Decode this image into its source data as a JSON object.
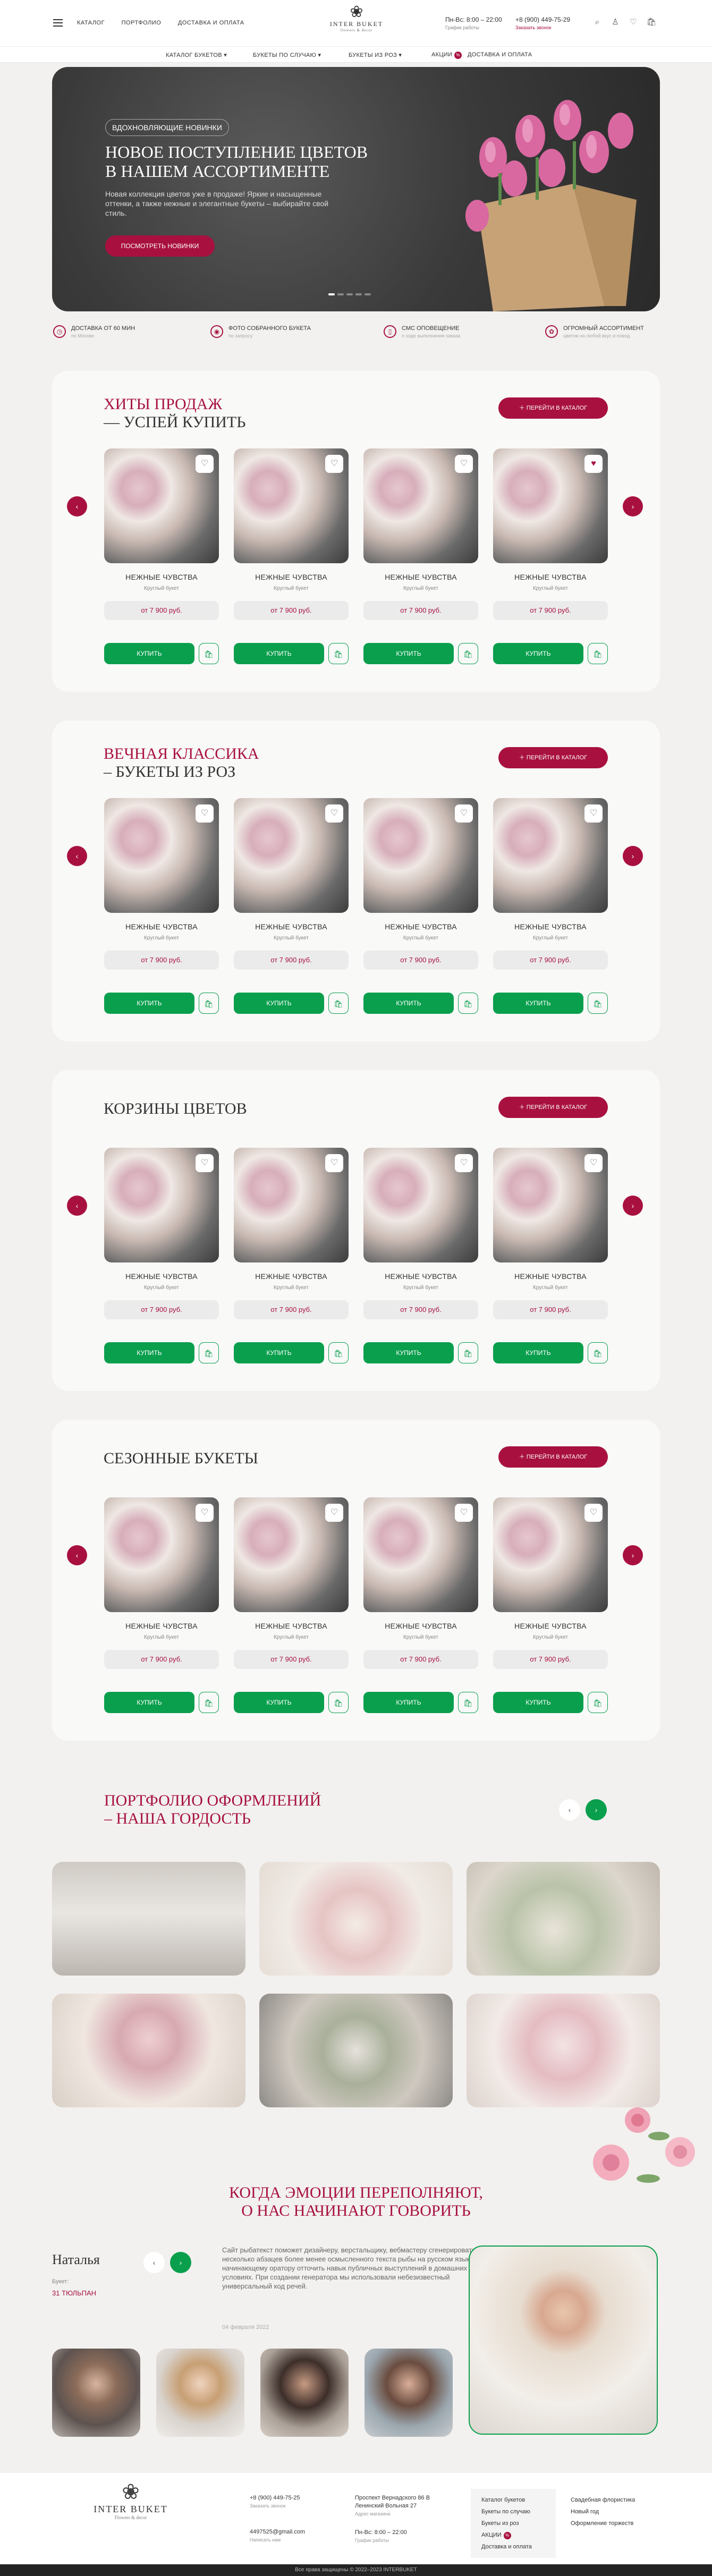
{
  "header": {
    "nav": [
      "КАТАЛОГ",
      "ПОРТФОЛИО",
      "ДОСТАВКА И ОПЛАТА"
    ],
    "logo_name": "INTER BUKET",
    "logo_sub": "flowers & decor",
    "hours": "Пн-Вс: 8:00 – 22:00",
    "hours_sub": "График работы",
    "phone": "+8 (900) 449-75-29",
    "phone_sub": "Заказать звонок",
    "cart_count": "0"
  },
  "catnav": {
    "items": [
      "КАТАЛОГ БУКЕТОВ",
      "БУКЕТЫ ПО СЛУЧАЮ",
      "БУКЕТЫ ИЗ РОЗ",
      "АКЦИИ",
      "ДОСТАВКА И ОПЛАТА"
    ],
    "sale_badge": "%"
  },
  "hero": {
    "tag": "ВДОХНОВЛЯЮЩИЕ НОВИНКИ",
    "title": "НОВОЕ ПОСТУПЛЕНИЕ ЦВЕТОВ В НАШЕМ АССОРТИМЕНТЕ",
    "text": "Новая коллекция цветов уже в продаже! Яркие и насыщенные оттенки, а также нежные и элегантные букеты – выбирайте свой стиль.",
    "button": "ПОСМОТРЕТЬ НОВИНКИ"
  },
  "features": [
    {
      "title": "ДОСТАВКА ОТ 60 МИН",
      "sub": "по Москве"
    },
    {
      "title": "ФОТО СОБРАННОГО БУКЕТА",
      "sub": "по запросу"
    },
    {
      "title": "СМС ОПОВЕЩЕНИЕ",
      "sub": "о ходе выполнения заказа"
    },
    {
      "title": "ОГРОМНЫЙ АССОРТИМЕНТ",
      "sub": "цветов на любой вкус и повод"
    }
  ],
  "more_button": "ПЕРЕЙТИ В КАТАЛОГ",
  "sections": [
    {
      "title": "ХИТЫ ПРОДАЖ",
      "sub": "— УСПЕЙ КУПИТЬ"
    },
    {
      "title": "ВЕЧНАЯ КЛАССИКА",
      "sub": "– БУКЕТЫ ИЗ РОЗ"
    },
    {
      "title": "КОРЗИНЫ ЦВЕТОВ",
      "sub": ""
    },
    {
      "title": "СЕЗОННЫЕ БУКЕТЫ",
      "sub": ""
    }
  ],
  "product": {
    "name": "НЕЖНЫЕ ЧУВСТВА",
    "type": "Круглый букет",
    "price": "от 7 900 руб.",
    "buy": "КУПИТЬ"
  },
  "portfolio": {
    "title": "ПОРТФОЛИО ОФОРМЛЕНИЙ",
    "sub": "– НАША ГОРДОСТЬ"
  },
  "emotions": {
    "line1": "КОГДА ЭМОЦИИ ПЕРЕПОЛНЯЮТ,",
    "line2": "О НАС НАЧИНАЮТ ГОВОРИТЬ"
  },
  "review": {
    "name": "Наталья",
    "key": "Букет:",
    "value": "31 ТЮЛЬПАН",
    "text": "Сайт рыбатекст поможет дизайнеру, верстальщику, вебмастеру сгенерировать несколько абзацев более менее осмысленного текста рыбы на русском языке, а начинающему оратору отточить навык публичных выступлений в домашних условиях. При создании генератора мы использовали небезизвестный универсальный код речей.",
    "date": "04 февраля 2022"
  },
  "footer": {
    "logo_name": "INTER BUKET",
    "logo_sub": "Flowers & decor",
    "phone1": "+8 (900) 449-75-25",
    "phone1_sub": "Заказать звонок",
    "email": "4497525@gmail.com",
    "email_sub": "Написать нам",
    "address": "Проспект Вернадского 86 В",
    "address2": "Ленинский Вольная 27",
    "address_sub": "Адрес магазина",
    "hours": "Пн-Вс: 8:00 – 22:00",
    "hours_sub": "График работы",
    "menu1": [
      "Каталог букетов",
      "Букеты по случаю",
      "Букеты из роз",
      "АКЦИИ",
      "Доставка и оплата"
    ],
    "menu2": [
      "Свадебная флористика",
      "Новый год",
      "Оформление торжеств"
    ],
    "copyright": "Все права защищены © 2022–2023 INTERBUKET"
  }
}
